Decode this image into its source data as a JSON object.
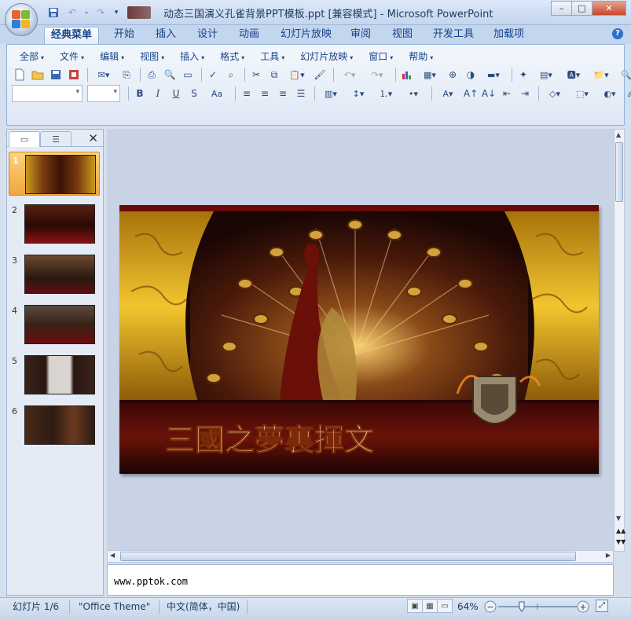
{
  "window": {
    "title": "动态三国演义孔雀背景PPT模板.ppt [兼容模式] - Microsoft PowerPoint",
    "controls": {
      "minimize": "–",
      "maximize": "□",
      "close": "✕"
    }
  },
  "ribbon_tabs": [
    {
      "label": "经典菜单",
      "active": true
    },
    {
      "label": "开始"
    },
    {
      "label": "插入"
    },
    {
      "label": "设计"
    },
    {
      "label": "动画"
    },
    {
      "label": "幻灯片放映"
    },
    {
      "label": "审阅"
    },
    {
      "label": "视图"
    },
    {
      "label": "开发工具"
    },
    {
      "label": "加载项"
    }
  ],
  "classic_menu": [
    "全部",
    "文件",
    "编辑",
    "视图",
    "插入",
    "格式",
    "工具",
    "幻灯片放映",
    "窗口",
    "帮助"
  ],
  "format_buttons": {
    "bold": "B",
    "italic": "I",
    "underline": "U",
    "shadow": "S",
    "change_case": "Aa",
    "font_color": "A"
  },
  "slides_panel": {
    "tabs": [
      "slides-tab",
      "outline-tab"
    ],
    "close": "✕",
    "slides": [
      {
        "number": "1",
        "selected": true,
        "tone": "#7a3a10"
      },
      {
        "number": "2",
        "tone": "#4a1810"
      },
      {
        "number": "3",
        "tone": "#3a2418"
      },
      {
        "number": "4",
        "tone": "#3a2014"
      },
      {
        "number": "5",
        "tone": "#2a1812"
      },
      {
        "number": "6",
        "tone": "#2e1a12"
      }
    ]
  },
  "slide": {
    "title_text": "三國之夢裏揮文"
  },
  "notes": {
    "text": "www.pptok.com"
  },
  "status": {
    "slide_counter": "幻灯片 1/6",
    "theme": "\"Office Theme\"",
    "language": "中文(简体，中国)",
    "zoom": "64%",
    "zoom_value": 64
  },
  "colors": {
    "accent": "#15428b",
    "selected_thumb": "#f2a53d"
  }
}
